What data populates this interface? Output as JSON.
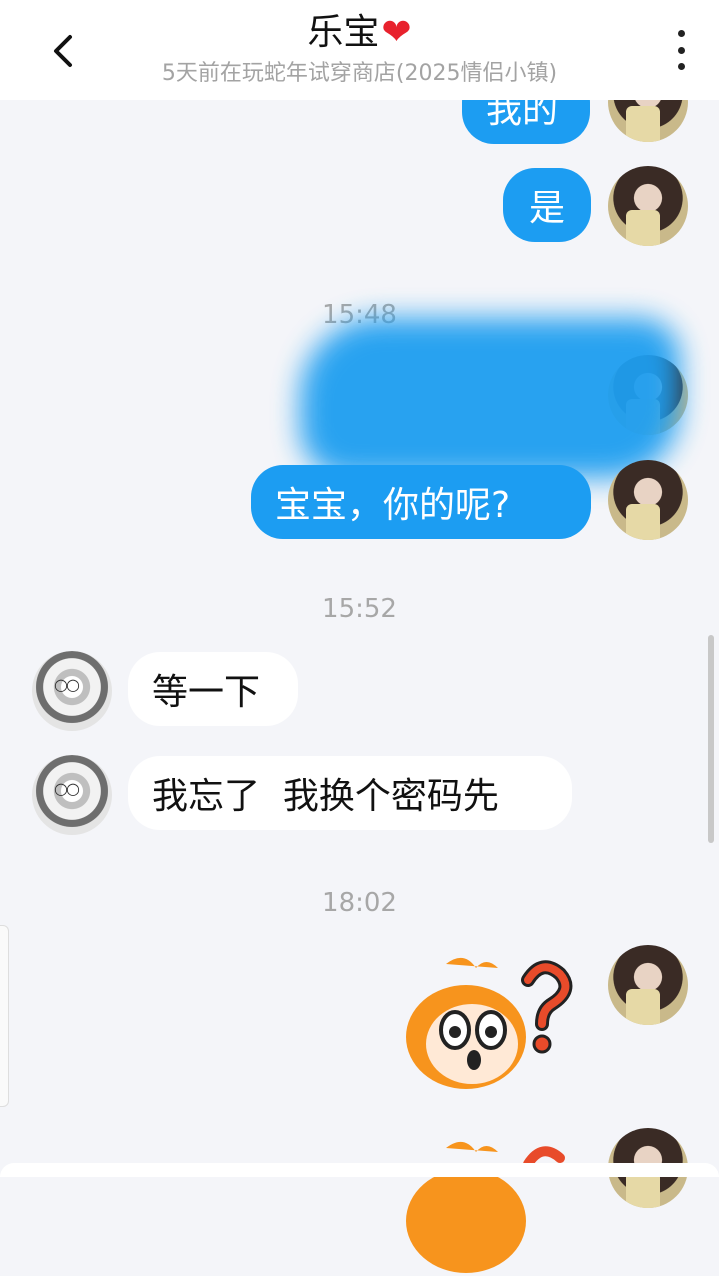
{
  "header": {
    "title": "乐宝",
    "title_icon": "heart-icon",
    "subtitle": "5天前在玩蛇年试穿商店(2025情侣小镇)"
  },
  "messages": [
    {
      "side": "out",
      "text": "我的",
      "partially_hidden": true
    },
    {
      "side": "out",
      "text": "是"
    },
    {
      "side": "out",
      "text": "宝宝，你的呢?",
      "partially_hidden": true
    },
    {
      "side": "in",
      "text": "等一下"
    },
    {
      "side": "in",
      "text": "我忘了  我换个密码先"
    }
  ],
  "timestamps": [
    "15:48",
    "15:52",
    "18:02"
  ],
  "colors": {
    "accent": "#1c9df2",
    "heart": "#e8222d",
    "background": "#f4f5f9"
  }
}
